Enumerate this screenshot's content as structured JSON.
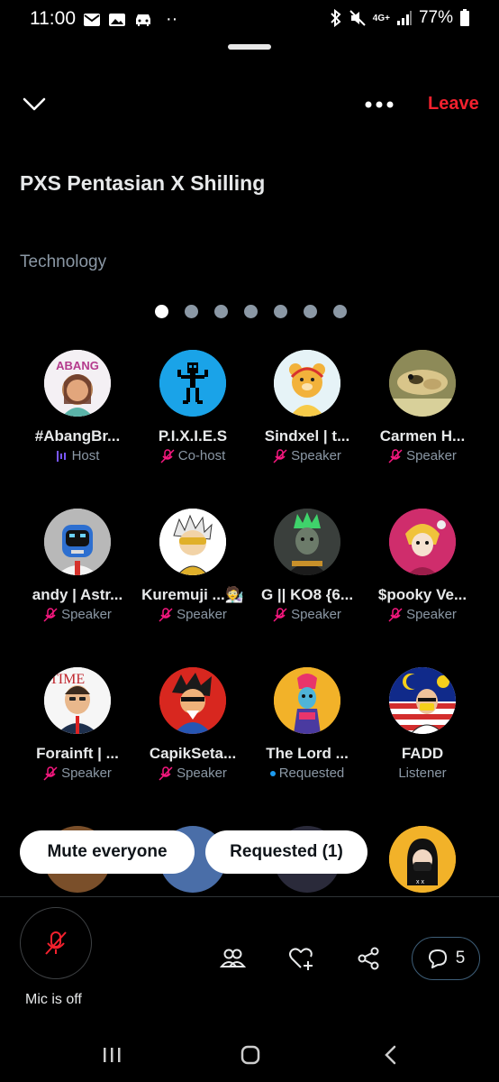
{
  "status_bar": {
    "time": "11:00",
    "battery_percent": "77%",
    "network": "4G+",
    "more_dots": "··"
  },
  "header": {
    "leave_label": "Leave"
  },
  "space": {
    "title": "PXS Pentasian X Shilling",
    "topic": "Technology",
    "page_index": 0,
    "page_count": 7
  },
  "participants": [
    {
      "name": "#AbangBr...",
      "role": "Host",
      "role_icon": "host-bars-icon"
    },
    {
      "name": "P.I.X.I.E.S",
      "role": "Co-host",
      "role_icon": "mic-muted-icon"
    },
    {
      "name": "Sindxel | t...",
      "role": "Speaker",
      "role_icon": "mic-muted-icon"
    },
    {
      "name": "Carmen H...",
      "role": "Speaker",
      "role_icon": "mic-muted-icon"
    },
    {
      "name": "andy | Astr...",
      "role": "Speaker",
      "role_icon": "mic-muted-icon"
    },
    {
      "name": "Kuremuji ...🧑‍🔬",
      "role": "Speaker",
      "role_icon": "mic-muted-icon"
    },
    {
      "name": "G || KO8 {6...",
      "role": "Speaker",
      "role_icon": "mic-muted-icon"
    },
    {
      "name": "$pooky Ve...",
      "role": "Speaker",
      "role_icon": "mic-muted-icon"
    },
    {
      "name": "Forainft | ...",
      "role": "Speaker",
      "role_icon": "mic-muted-icon"
    },
    {
      "name": "CapikSeta...",
      "role": "Speaker",
      "role_icon": "mic-muted-icon"
    },
    {
      "name": "The Lord ...",
      "role": "Requested",
      "role_icon": "requested-dot"
    },
    {
      "name": "FADD",
      "role": "Listener",
      "role_icon": ""
    }
  ],
  "actions": {
    "mute_everyone": "Mute everyone",
    "requested": "Requested (1)"
  },
  "footer": {
    "mic_label": "Mic is off",
    "chat_count": "5"
  },
  "colors": {
    "background": "#000000",
    "accent_red": "#f4212e",
    "muted_pink": "#f91880",
    "host_purple": "#7856ff",
    "requested_blue": "#1d9bf0",
    "secondary_text": "#8b98a5"
  }
}
